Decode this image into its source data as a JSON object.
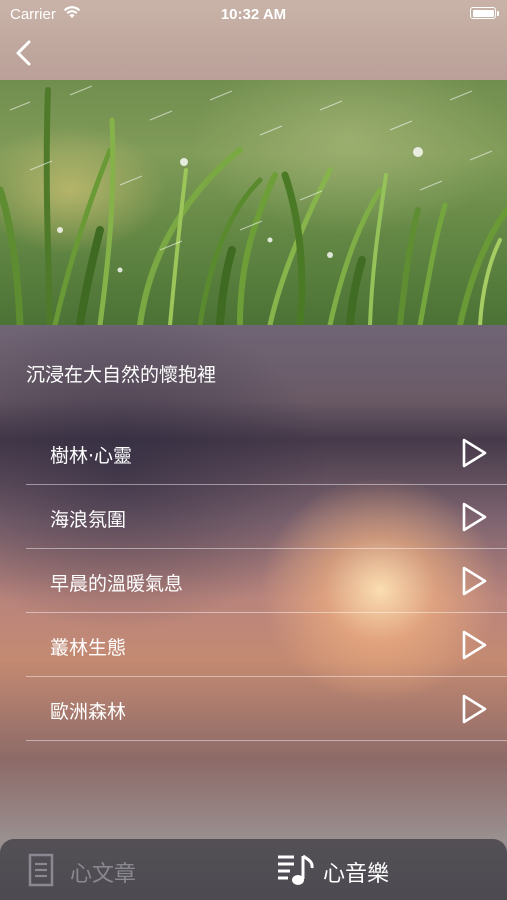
{
  "status_bar": {
    "carrier": "Carrier",
    "time": "10:32 AM"
  },
  "nav": {
    "back_icon": "chevron-left-icon"
  },
  "hero": {
    "image": "grass-rain-photo"
  },
  "section": {
    "title": "沉浸在大自然的懷抱裡"
  },
  "tracks": [
    {
      "label": "樹林·心靈",
      "icon": "play-icon"
    },
    {
      "label": "海浪氛圍",
      "icon": "play-icon"
    },
    {
      "label": "早晨的溫暖氣息",
      "icon": "play-icon"
    },
    {
      "label": "叢林生態",
      "icon": "play-icon"
    },
    {
      "label": "歐洲森林",
      "icon": "play-icon"
    }
  ],
  "tabbar": {
    "tabs": [
      {
        "label": "心文章",
        "icon": "document-icon",
        "active": false
      },
      {
        "label": "心音樂",
        "icon": "music-list-icon",
        "active": true
      }
    ]
  },
  "colors": {
    "text": "#ffffff",
    "inactive_tab": "#8a8890",
    "tabbar_bg": "#46444b"
  }
}
